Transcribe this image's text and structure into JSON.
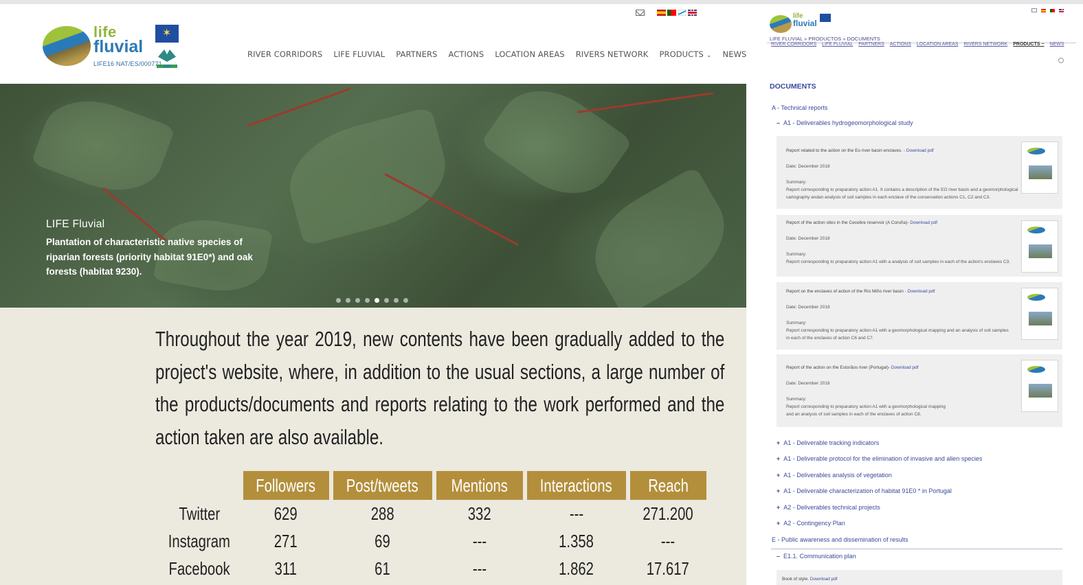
{
  "left": {
    "logo": {
      "line1": "life",
      "line2": "fluvial",
      "code": "LIFE16 NAT/ES/000771"
    },
    "nav": [
      {
        "label": "RIVER CORRIDORS"
      },
      {
        "label": "LIFE FLUVIAL"
      },
      {
        "label": "PARTNERS"
      },
      {
        "label": "ACTIONS"
      },
      {
        "label": "LOCATION AREAS"
      },
      {
        "label": "RIVERS NETWORK"
      },
      {
        "label": "PRODUCTS",
        "caret": "⌄"
      },
      {
        "label": "NEWS"
      }
    ],
    "icons": {
      "mail": "envelope-icon",
      "search": "search-icon"
    },
    "hero": {
      "title": "LIFE Fluvial",
      "text": "Plantation of characteristic native species of riparian forests (priority habitat 91E0*) and oak forests (habitat 9230).",
      "slide_count": 8,
      "active_slide": 5
    },
    "paragraph": "Throughout the year 2019, new contents have been gradually added to the project's website, where, in addition to the usual sections, a large number of the products/documents and reports relating to the work performed and the action taken are also available.",
    "stats": {
      "header_color": "#b38f3c",
      "columns": [
        "Followers",
        "Post/tweets",
        "Mentions",
        "Interactions",
        "Reach"
      ],
      "rows": [
        {
          "network": "Twitter",
          "values": [
            "629",
            "288",
            "332",
            "---",
            "271.200"
          ]
        },
        {
          "network": "Instagram",
          "values": [
            "271",
            "69",
            "---",
            "1.358",
            "---"
          ]
        },
        {
          "network": "Facebook",
          "values": [
            "311",
            "61",
            "---",
            "1.862",
            "17.617"
          ]
        }
      ]
    }
  },
  "right": {
    "logo": {
      "line1": "life",
      "line2": "fluvial"
    },
    "breadcrumb": "LIFE FLUVIAL » PRODUCTOS » DOCUMENTS",
    "nav": [
      "RIVER CORRIDORS",
      "LIFE FLUVIAL",
      "PARTNERS",
      "ACTIONS",
      "LOCATION AREAS",
      "RIVERS NETWORK",
      "PRODUCTS ~",
      "NEWS"
    ],
    "heading": "DOCUMENTS",
    "section_a": "A - Technical reports",
    "a1_open": "A1 - Deliverables hydrogeomorphological study",
    "cards": [
      {
        "title": "Report related to the action on the Eo river basin enclaves. -",
        "link": "Download pdf",
        "date": "Date: December 2018",
        "summary_label": "Summary:",
        "summary": [
          "Report corresponding to preparatory action A1. It contains a description of the EO river basin and a geomorphological",
          "cartography andan analysis of soil samples in each enclave of the conservation actions C1, C2 and C3."
        ]
      },
      {
        "title": "Report of the action sites in the Cecebre reservoir (A Coruña)-",
        "link": "Download pdf",
        "date": "Date: December 2018",
        "summary_label": "Summary:",
        "summary": [
          "Report corresponding to preparatory action A1 with a analysis of soil samples in each of the action's enclaves C3."
        ]
      },
      {
        "title": "Report on the enclaves of action of the Río Miño river basin -",
        "link": "Download pdf",
        "date": "Date: December 2018",
        "summary_label": "Summary:",
        "summary": [
          "Report corresponding to preparatory action A1 with a geomorphological mapping and an analysis of soil samples",
          "in each of the enclaves of action C6 and C7."
        ]
      },
      {
        "title": "Report of the action on the Estorãos river (Portugal)-",
        "link": "Download pdf",
        "date": "Date: December 2018",
        "summary_label": "Summary:",
        "summary": [
          "Report corresponding to preparatory action A1 with a geomorphological mapping",
          "and an analysis of soil samples in each of the enclaves of action C8."
        ]
      }
    ],
    "collapsed": [
      "A1 - Deliverable tracking indicators",
      "A1 - Deliverable protocol for the elimination of invasive and alien species",
      "A1 - Deliverables analysis of vegetation",
      "A1 - Deliverable characterization of habitat 91E0 * in Portugal",
      "A2 - Deliverables technical projects",
      "A2 - Contingency Plan"
    ],
    "section_e": "E - Public awareness and dissemination of results",
    "e_open": "E1.1. Communication plan",
    "last_item": {
      "title": "Book of style.",
      "link": "Download pdf"
    }
  }
}
